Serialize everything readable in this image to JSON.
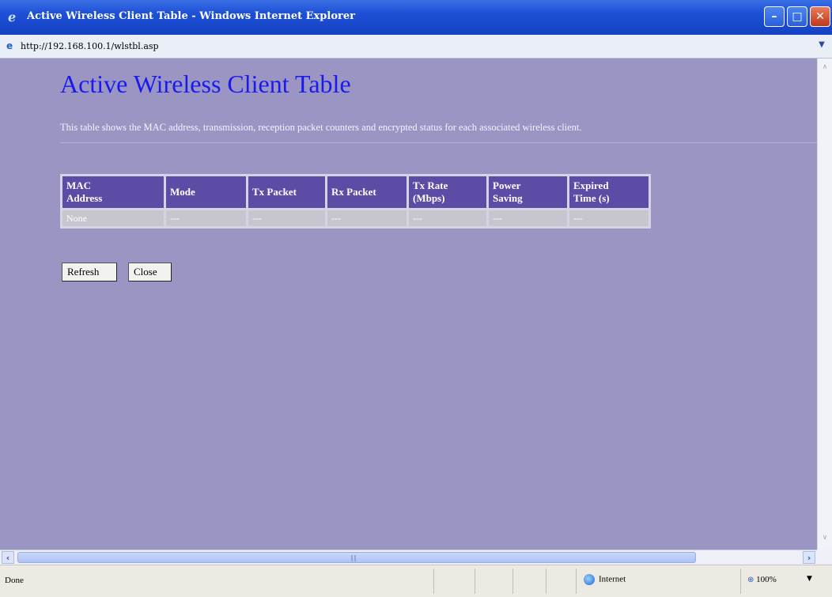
{
  "window": {
    "title": "Active Wireless Client Table - Windows Internet Explorer",
    "address": "http://192.168.100.1/wlstbl.asp"
  },
  "page": {
    "heading": "Active Wireless Client Table",
    "description": "This table shows the MAC address, transmission, reception packet counters and encrypted status for each associated wireless client."
  },
  "table": {
    "headers": [
      [
        "MAC",
        "Address"
      ],
      [
        "Mode",
        ""
      ],
      [
        "Tx Packet",
        ""
      ],
      [
        "Rx Packet",
        ""
      ],
      [
        "Tx Rate",
        "(Mbps)"
      ],
      [
        "Power",
        "Saving"
      ],
      [
        "Expired",
        "Time (s)"
      ]
    ],
    "rows": [
      [
        "None",
        "---",
        "---",
        "---",
        "---",
        "---",
        "---"
      ]
    ]
  },
  "buttons": {
    "refresh": "Refresh",
    "close": "Close"
  },
  "status": {
    "text": "Done",
    "zone": "Internet",
    "zoom": "100%"
  },
  "colors": {
    "title_bar": "#1d4fd6",
    "page_bg": "#9b95c4",
    "header_cell": "#5c4ca6",
    "heading_text": "#1a1aee"
  },
  "icons": [
    "ie-icon",
    "minimize-icon",
    "maximize-icon",
    "close-icon",
    "globe-icon",
    "zoom-icon"
  ]
}
